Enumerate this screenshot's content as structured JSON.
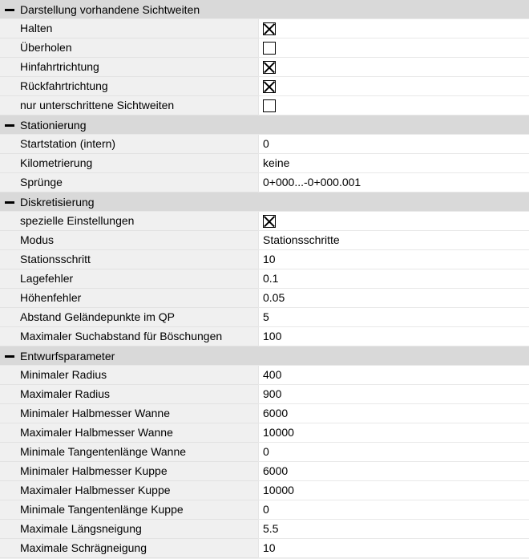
{
  "sections": [
    {
      "title": "Darstellung vorhandene Sichtweiten",
      "rows": [
        {
          "label": "Halten",
          "type": "checkbox",
          "checked": true
        },
        {
          "label": "Überholen",
          "type": "checkbox",
          "checked": false
        },
        {
          "label": "Hinfahrtrichtung",
          "type": "checkbox",
          "checked": true
        },
        {
          "label": "Rückfahrtrichtung",
          "type": "checkbox",
          "checked": true
        },
        {
          "label": "nur unterschrittene Sichtweiten",
          "type": "checkbox",
          "checked": false
        }
      ]
    },
    {
      "title": "Stationierung",
      "rows": [
        {
          "label": "Startstation (intern)",
          "type": "text",
          "value": "0"
        },
        {
          "label": "Kilometrierung",
          "type": "text",
          "value": "keine"
        },
        {
          "label": "Sprünge",
          "type": "text",
          "value": "0+000...-0+000.001"
        }
      ]
    },
    {
      "title": "Diskretisierung",
      "rows": [
        {
          "label": "spezielle Einstellungen",
          "type": "checkbox",
          "checked": true
        },
        {
          "label": "Modus",
          "type": "text",
          "value": "Stationsschritte"
        },
        {
          "label": "Stationsschritt",
          "type": "text",
          "value": "10"
        },
        {
          "label": "Lagefehler",
          "type": "text",
          "value": "0.1"
        },
        {
          "label": "Höhenfehler",
          "type": "text",
          "value": "0.05"
        },
        {
          "label": "Abstand Geländepunkte im QP",
          "type": "text",
          "value": "5"
        },
        {
          "label": "Maximaler Suchabstand für Böschungen",
          "type": "text",
          "value": "100"
        }
      ]
    },
    {
      "title": "Entwurfsparameter",
      "rows": [
        {
          "label": "Minimaler Radius",
          "type": "text",
          "value": "400"
        },
        {
          "label": "Maximaler Radius",
          "type": "text",
          "value": "900"
        },
        {
          "label": "Minimaler Halbmesser Wanne",
          "type": "text",
          "value": "6000"
        },
        {
          "label": "Maximaler Halbmesser Wanne",
          "type": "text",
          "value": "10000"
        },
        {
          "label": "Minimale Tangentenlänge Wanne",
          "type": "text",
          "value": "0"
        },
        {
          "label": "Minimaler Halbmesser Kuppe",
          "type": "text",
          "value": "6000"
        },
        {
          "label": "Maximaler Halbmesser Kuppe",
          "type": "text",
          "value": "10000"
        },
        {
          "label": "Minimale Tangentenlänge Kuppe",
          "type": "text",
          "value": "0"
        },
        {
          "label": "Maximale Längsneigung",
          "type": "text",
          "value": "5.5"
        },
        {
          "label": "Maximale Schrägneigung",
          "type": "text",
          "value": "10"
        }
      ]
    }
  ]
}
